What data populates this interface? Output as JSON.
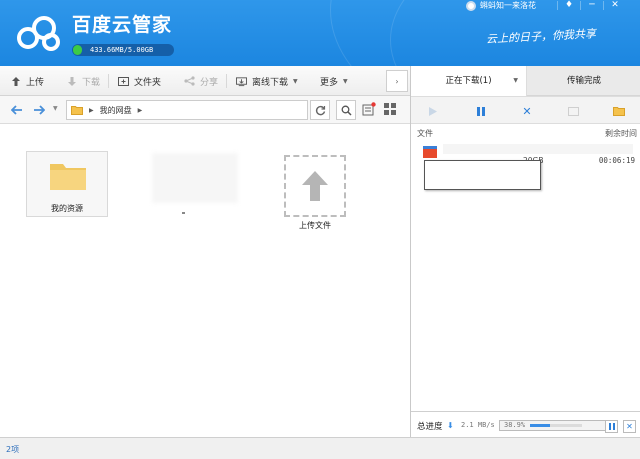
{
  "header": {
    "app_title": "百度云管家",
    "quota_text": "433.66MB/5.00GB",
    "quota_fraction": 0.085,
    "username": "蝌蚪知一来洛花",
    "slogan": "云上的日子，你我共享",
    "win_controls": [
      "♦",
      "─",
      "✕"
    ]
  },
  "toolbar": {
    "upload": "上传",
    "download": "下载",
    "new_folder": "文件夹",
    "share": "分享",
    "offline_download": "离线下载",
    "more": "更多",
    "collapse": "›"
  },
  "nav": {
    "path_root": "我的网盘"
  },
  "files": {
    "folder_name": "我的资源",
    "upload_label": "上传文件"
  },
  "transfer": {
    "tab_downloading": "正在下载(1)",
    "tab_done": "传输完成",
    "col_file": "文件",
    "col_remaining": "剩余时间",
    "item": {
      "size": "20GB",
      "remaining": "00:06:19"
    }
  },
  "footer": {
    "total_label": "总进度",
    "speed": "2.1 MB/s",
    "percent_text": "38.9%",
    "progress": 0.389
  },
  "status": {
    "count": "2项"
  },
  "colors": {
    "header_blue": "#1c86e0",
    "accent_blue": "#3a8ee6",
    "quota_green": "#3ccb46"
  }
}
